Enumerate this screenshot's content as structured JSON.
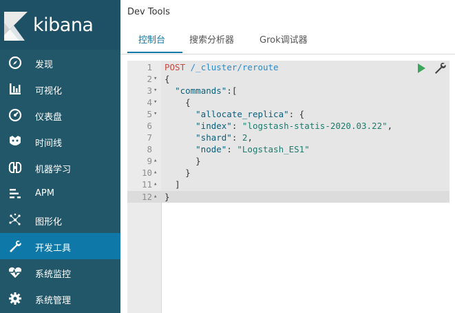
{
  "brand": {
    "name": "kibana"
  },
  "nav": {
    "items": [
      {
        "label": "发现",
        "icon": "compass-icon"
      },
      {
        "label": "可视化",
        "icon": "bar-chart-icon"
      },
      {
        "label": "仪表盘",
        "icon": "dashboard-icon"
      },
      {
        "label": "时间线",
        "icon": "timeline-icon"
      },
      {
        "label": "机器学习",
        "icon": "machine-learning-icon"
      },
      {
        "label": "APM",
        "icon": "apm-icon"
      },
      {
        "label": "图形化",
        "icon": "graph-icon"
      },
      {
        "label": "开发工具",
        "icon": "wrench-icon",
        "active": true
      },
      {
        "label": "系统监控",
        "icon": "heartbeat-icon"
      },
      {
        "label": "系统管理",
        "icon": "gear-icon"
      }
    ]
  },
  "header": {
    "title": "Dev Tools"
  },
  "tabs": [
    {
      "label": "控制台",
      "active": true
    },
    {
      "label": "搜索分析器"
    },
    {
      "label": "Grok调试器"
    }
  ],
  "editor": {
    "lines": [
      {
        "num": "1",
        "fold": ""
      },
      {
        "num": "2",
        "fold": "▾"
      },
      {
        "num": "3",
        "fold": "▾"
      },
      {
        "num": "4",
        "fold": "▾"
      },
      {
        "num": "5",
        "fold": "▾"
      },
      {
        "num": "6",
        "fold": ""
      },
      {
        "num": "7",
        "fold": ""
      },
      {
        "num": "8",
        "fold": ""
      },
      {
        "num": "9",
        "fold": "▴"
      },
      {
        "num": "10",
        "fold": "▴"
      },
      {
        "num": "11",
        "fold": "▴"
      },
      {
        "num": "12",
        "fold": "▴"
      }
    ],
    "method": "POST",
    "path": "/_cluster/reroute",
    "key_commands": "\"commands\"",
    "key_allocate": "\"allocate_replica\"",
    "key_index": "\"index\"",
    "val_index": "\"logstash-statis-2020.03.22\"",
    "key_shard": "\"shard\"",
    "val_shard": "2",
    "key_node": "\"node\"",
    "val_node": "\"Logstash_ES1\""
  },
  "colors": {
    "sidebar": "#22576a",
    "active": "#0e79a8",
    "run": "#3ba55c"
  }
}
